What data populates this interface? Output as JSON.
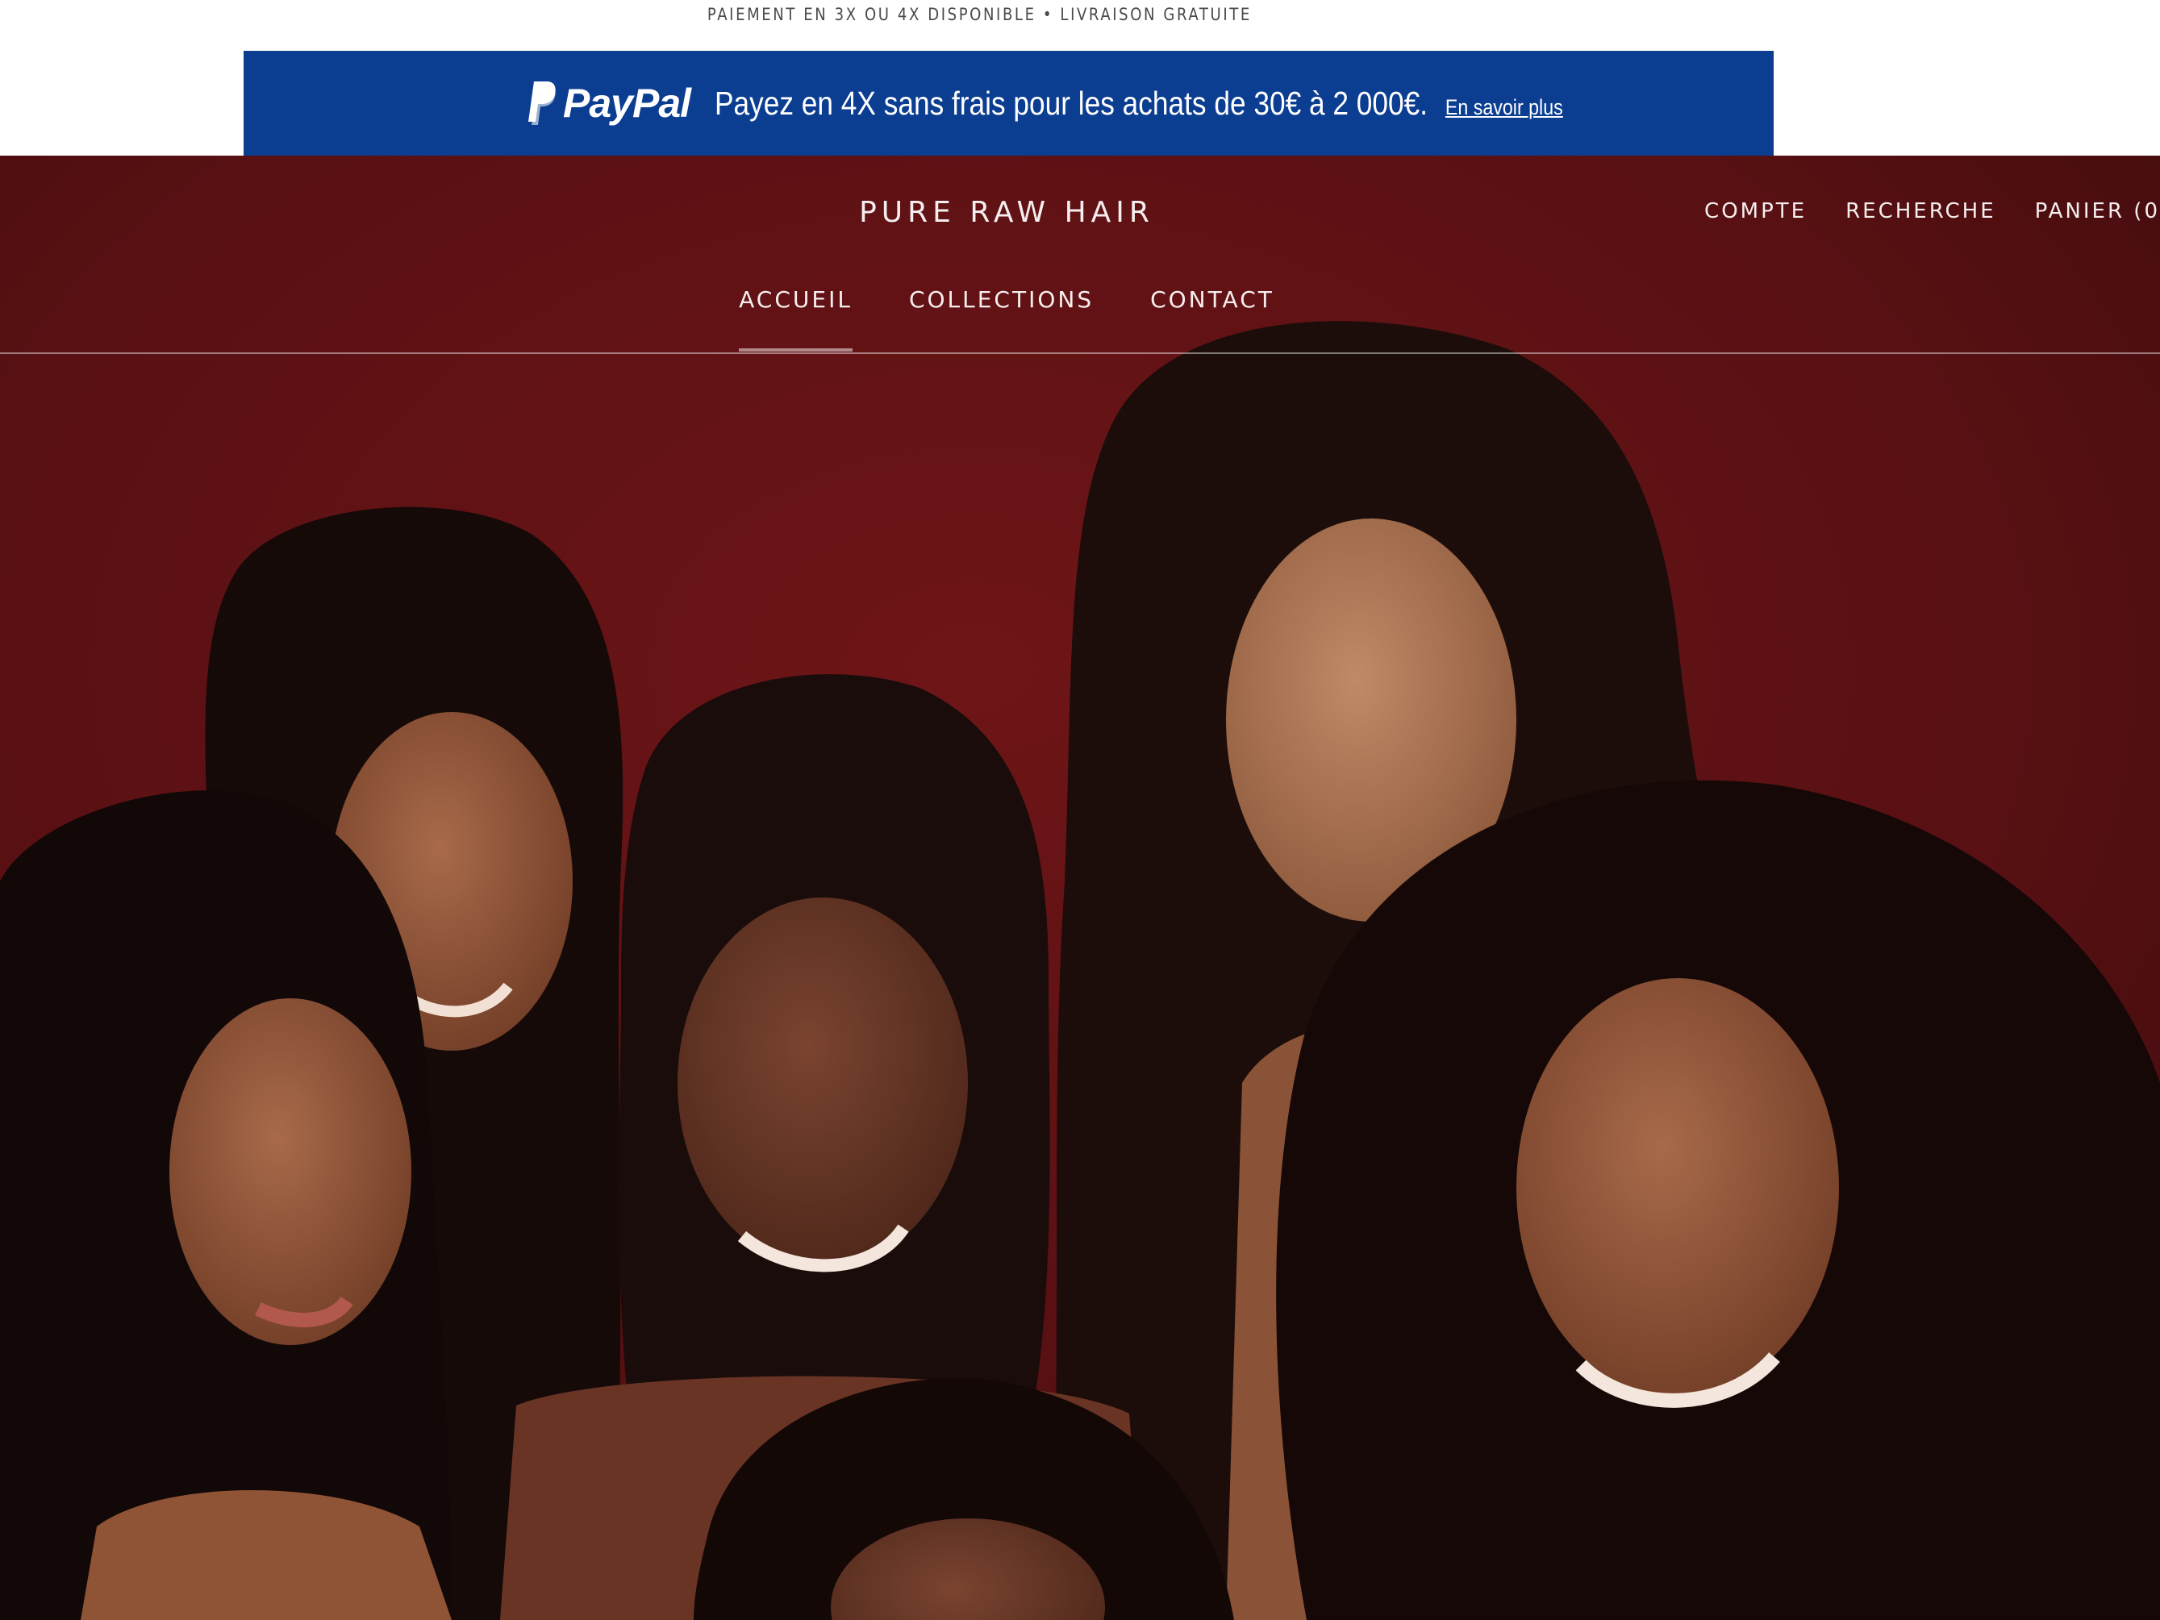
{
  "announcement": {
    "text": "PAIEMENT EN 3X OU 4X DISPONIBLE • LIVRAISON GRATUITE"
  },
  "paypal_banner": {
    "logo_text": "PayPal",
    "message": "Payez en 4X sans frais pour les achats de 30€ à 2 000€.",
    "link_label": "En savoir plus"
  },
  "header": {
    "brand": "PURE RAW HAIR",
    "links": {
      "account": "COMPTE",
      "search": "RECHERCHE",
      "cart": "PANIER (0"
    }
  },
  "nav": {
    "items": [
      {
        "label": "ACCUEIL",
        "active": true
      },
      {
        "label": "COLLECTIONS",
        "active": false
      },
      {
        "label": "CONTACT",
        "active": false
      }
    ]
  },
  "hero": {
    "background_color": "#5a1013"
  },
  "colors": {
    "paypal_blue": "#0b3d91",
    "header_text": "#f6eeee",
    "hero_red": "#5a1013"
  }
}
